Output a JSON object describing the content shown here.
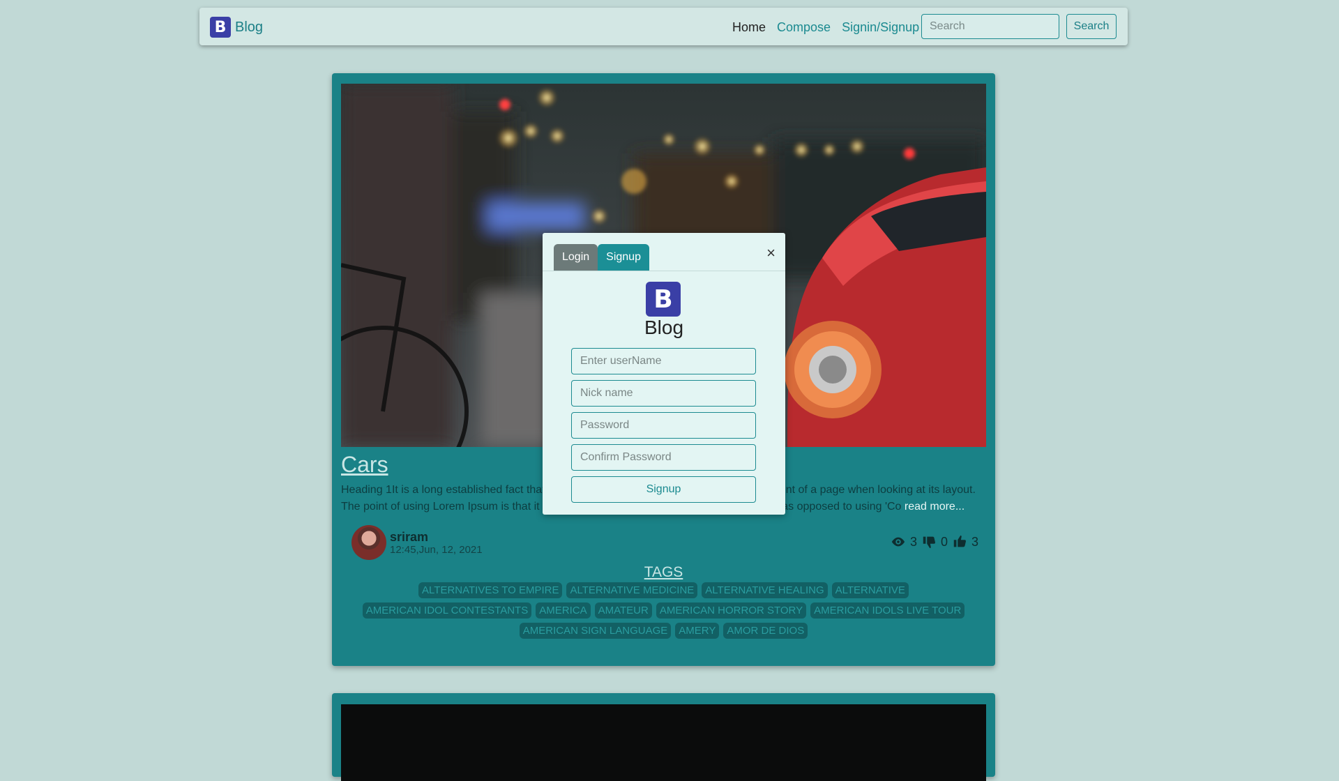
{
  "navbar": {
    "brand_logo": "B",
    "brand_text": "Blog",
    "links": [
      "Home",
      "Compose",
      "Signin/Signup"
    ],
    "search_placeholder": "Search",
    "search_button": "Search"
  },
  "post": {
    "title": "Cars",
    "excerpt": "Heading 1It is a long established fact that a reader will be distracted by the readable content of a page when looking at its layout. The point of using Lorem Ipsum is that it has a more-or-less normal distribution of letters, as opposed to using 'Co",
    "read_more": "read more...",
    "author": "sriram",
    "time": "12:45,Jun, 12, 2021",
    "views": "3",
    "dislikes": "0",
    "likes": "3",
    "tags_heading": "TAGS",
    "tags": [
      "ALTERNATIVES TO EMPIRE",
      "ALTERNATIVE MEDICINE",
      "ALTERNATIVE HEALING",
      "ALTERNATIVE",
      "AMERICAN IDOL CONTESTANTS",
      "AMERICA",
      "AMATEUR",
      "AMERICAN HORROR STORY",
      "AMERICAN IDOLS LIVE TOUR",
      "AMERICAN SIGN LANGUAGE",
      "AMERY",
      "AMOR DE DIOS"
    ]
  },
  "modal": {
    "tab_login": "Login",
    "tab_signup": "Signup",
    "close": "×",
    "logo": "B",
    "brand": "Blog",
    "username_placeholder": "Enter userName",
    "nickname_placeholder": "Nick name",
    "password_placeholder": "Password",
    "confirm_placeholder": "Confirm Password",
    "submit": "Signup"
  },
  "colors": {
    "accent": "#1b8a90",
    "card": "#1a8287",
    "logo": "#3a3fa6",
    "background": "#c1d9d6"
  }
}
